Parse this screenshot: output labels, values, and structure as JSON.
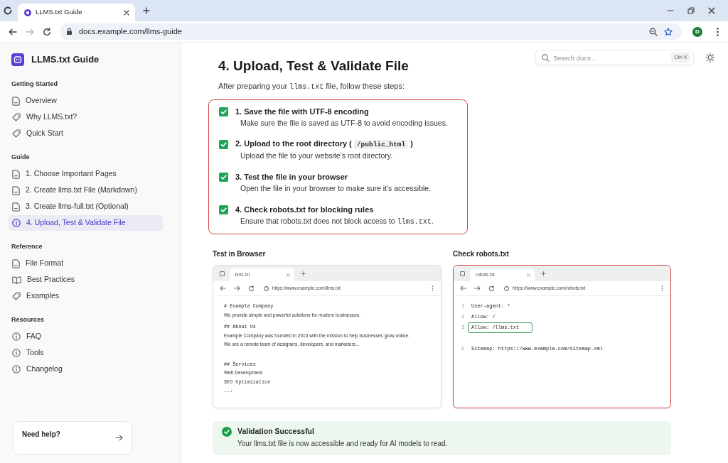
{
  "browser": {
    "tabs": [
      {
        "title": "LLMS.txt Guide",
        "selected": true
      }
    ],
    "nav_buttons": [
      {
        "kind": "back",
        "disabled": false
      },
      {
        "kind": "forward",
        "disabled": true
      },
      {
        "kind": "reload",
        "disabled": false
      }
    ],
    "address": "docs.example.com/llms-guide",
    "profile_initial": "D"
  },
  "sidebar": {
    "brand": "LLMS.txt Guide",
    "sections": [
      {
        "heading": "Getting Started",
        "items": [
          {
            "label": "Overview",
            "kind": "doc",
            "selected": false
          },
          {
            "label": "Why LLMS.txt?",
            "kind": "tag",
            "selected": false
          },
          {
            "label": "Quick Start",
            "kind": "tag",
            "selected": false
          }
        ]
      },
      {
        "heading": "Guide",
        "items": [
          {
            "label": "1. Choose Important Pages",
            "kind": "doc",
            "selected": false
          },
          {
            "label": "2. Create llms.txt File (Markdown)",
            "kind": "doc",
            "selected": false
          },
          {
            "label": "3. Create llms-full.txt (Optional)",
            "kind": "doc",
            "selected": false
          },
          {
            "label": "4. Upload, Test & Validate File",
            "kind": "circle",
            "selected": true
          }
        ]
      },
      {
        "heading": "Reference",
        "items": [
          {
            "label": "File Format",
            "kind": "doc",
            "selected": false
          },
          {
            "label": "Best Practices",
            "kind": "book",
            "selected": false
          },
          {
            "label": "Examples",
            "kind": "tag",
            "selected": false
          }
        ]
      },
      {
        "heading": "Resources",
        "items": [
          {
            "label": "FAQ",
            "kind": "circle",
            "selected": false
          },
          {
            "label": "Tools",
            "kind": "circle",
            "selected": false
          },
          {
            "label": "Changelog",
            "kind": "circle",
            "selected": false
          }
        ]
      }
    ],
    "help": {
      "title": "Need help?"
    }
  },
  "search": {
    "placeholder": "Search docs...",
    "shortcut": "Ctrl K"
  },
  "page": {
    "title": "4. Upload, Test & Validate File",
    "intro": [
      {
        "kind": "text",
        "text": "After preparing your "
      },
      {
        "kind": "code",
        "text": "llms.txt"
      },
      {
        "kind": "text",
        "text": " file, follow these steps:"
      }
    ],
    "steps_panel": {
      "highlighted": true,
      "steps": [
        {
          "checked": true,
          "title": [
            {
              "kind": "text",
              "text": "1. Save the file with UTF-8 encoding"
            }
          ],
          "description": [
            {
              "kind": "text",
              "text": "Make sure the file is saved as UTF-8 to avoid encoding issues."
            }
          ]
        },
        {
          "checked": true,
          "title": [
            {
              "kind": "text",
              "text": "2. Upload to the root directory ( "
            },
            {
              "kind": "code_chip",
              "text": "/public_html"
            },
            {
              "kind": "text",
              "text": " )"
            }
          ],
          "description": [
            {
              "kind": "text",
              "text": "Upload the file to your website's root directory."
            }
          ]
        },
        {
          "checked": true,
          "title": [
            {
              "kind": "text",
              "text": "3. Test the file in your browser"
            }
          ],
          "description": [
            {
              "kind": "text",
              "text": "Open the file in your browser to make sure it's accessible."
            }
          ]
        },
        {
          "checked": true,
          "title": [
            {
              "kind": "text",
              "text": "4. Check robots.txt for blocking rules"
            }
          ],
          "description": [
            {
              "kind": "text",
              "text": "Ensure that robots.txt does not block access to "
            },
            {
              "kind": "code",
              "text": "llms.txt"
            },
            {
              "kind": "text",
              "text": "."
            }
          ]
        }
      ]
    },
    "previews": [
      {
        "heading": "Test in Browser",
        "highlighted": false,
        "tab_title": "llms.txt",
        "url": "https://www.example.com/llms.txt",
        "blocks": [
          {
            "lines": [
              {
                "kind": "heading",
                "text": "# Example Company"
              },
              {
                "kind": "text",
                "text": "We provide simple and powerful solutions for modern businesses."
              },
              {
                "kind": "heading",
                "text": "## About Us"
              },
              {
                "kind": "text",
                "text": "Example Company was founded in 2015 with the mission to help businesses grow online."
              },
              {
                "kind": "text",
                "text": "We are a remote team of designers, developers, and marketers..."
              }
            ]
          },
          {
            "lines": [
              {
                "kind": "heading",
                "text": "## Services"
              },
              {
                "kind": "text",
                "text": "Web Development"
              },
              {
                "kind": "mono",
                "text": "SEO Optimization"
              },
              {
                "kind": "mono",
                "text": "..."
              }
            ]
          }
        ]
      },
      {
        "heading": "Check robots.txt",
        "highlighted": true,
        "tab_title": "robots.txt",
        "url": "https://www.example.com/robots.txt",
        "blocks": [
          {
            "lines": [
              {
                "kind": "code",
                "number": "1",
                "text": "User-agent: *",
                "highlighted": false
              },
              {
                "kind": "code",
                "number": "2",
                "text": "Allow: /",
                "highlighted": false
              },
              {
                "kind": "code",
                "number": "3",
                "text": "Allow: /llms.txt",
                "highlighted": true
              }
            ]
          },
          {
            "lines": [
              {
                "kind": "code",
                "number": "5",
                "text": "Sitemap: https://www.example.com/sitemap.xml",
                "highlighted": false
              }
            ]
          }
        ]
      }
    ],
    "validation": {
      "title": "Validation Successful",
      "message": "Your llms.txt file is now accessible and ready for AI models to read."
    }
  }
}
